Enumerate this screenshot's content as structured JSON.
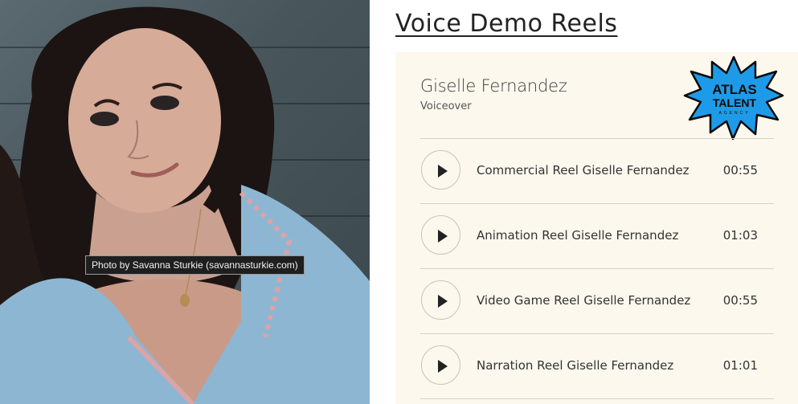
{
  "photo": {
    "caption": "Photo by Savanna Sturkie (savannasturkie.com)"
  },
  "page": {
    "title": "Voice Demo Reels"
  },
  "artist": {
    "name": "Giselle Fernandez",
    "role": "Voiceover"
  },
  "logo": {
    "line1": "ATLAS",
    "line2": "TALENT",
    "line3": "AGENCY",
    "color": "#1e9be8"
  },
  "tracks": [
    {
      "name": "Commercial Reel Giselle Fernandez",
      "duration": "00:55"
    },
    {
      "name": "Animation Reel Giselle Fernandez",
      "duration": "01:03"
    },
    {
      "name": "Video Game Reel Giselle Fernandez",
      "duration": "00:55"
    },
    {
      "name": "Narration Reel Giselle Fernandez",
      "duration": "01:01"
    }
  ]
}
